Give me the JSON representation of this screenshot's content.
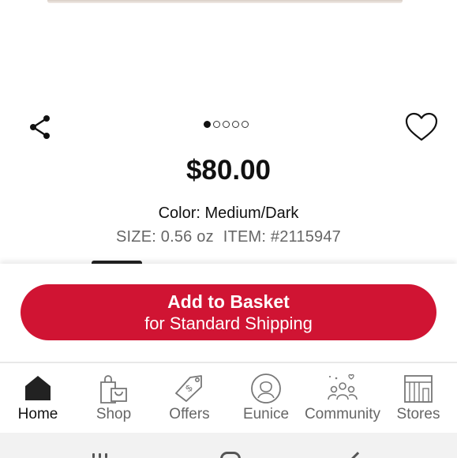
{
  "product": {
    "price": "$80.00",
    "color_line": "Color: Medium/Dark",
    "size": "SIZE: 0.56 oz",
    "item": "ITEM: #2115947"
  },
  "carousel": {
    "total": 5,
    "active_index": 0
  },
  "cta": {
    "line1": "Add to Basket",
    "line2": "for Standard Shipping",
    "color": "#d01433"
  },
  "nav": {
    "items": [
      {
        "label": "Home",
        "icon": "home-icon",
        "active": true
      },
      {
        "label": "Shop",
        "icon": "shopping-bag-icon",
        "active": false
      },
      {
        "label": "Offers",
        "icon": "price-tag-icon",
        "active": false
      },
      {
        "label": "Eunice",
        "icon": "user-profile-icon",
        "active": false
      },
      {
        "label": "Community",
        "icon": "community-icon",
        "active": false
      },
      {
        "label": "Stores",
        "icon": "store-icon",
        "active": false
      }
    ]
  }
}
